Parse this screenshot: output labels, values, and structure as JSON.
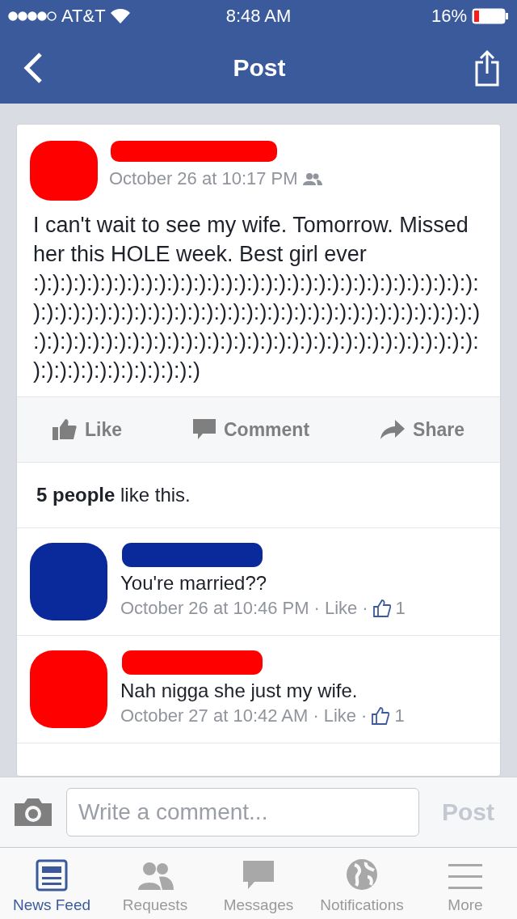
{
  "status_bar": {
    "carrier": "AT&T",
    "time": "8:48 AM",
    "battery": "16%"
  },
  "nav": {
    "title": "Post"
  },
  "post": {
    "time": "October 26 at 10:17 PM",
    "color": "#ff0000",
    "text": "I can't wait to see my wife. Tomorrow. Missed her this HOLE week. Best girl ever :):):):):):):):):):):):):):):):):):):):):):):):):):):):):):):):):):):):):):):):):):):):):):):):):):):):):):):):):):):):):):):):):):):):):):):):):):):):):):):):):):):):):):):):):):):):):):):):):):):):):):):):):):):):):):):):):)",
    "actions": [
      {
        "kind": "like",
        "label": "Like"
      },
      {
        "kind": "comment",
        "label": "Comment"
      },
      {
        "kind": "share",
        "label": "Share"
      }
    ],
    "likes": "**5 people** like this."
  },
  "comments": [
    {
      "color": "#0a2a9c",
      "text": "You're married??",
      "time": "October 26 at 10:46 PM",
      "dot_1": "·",
      "like": "Like",
      "dot_2": "·",
      "count": "1"
    },
    {
      "color": "#ff0000",
      "text": "Nah nigga she just my wife.",
      "time": "October 27 at 10:42 AM",
      "dot_1": "·",
      "like": "Like",
      "dot_2": "·",
      "count": "1"
    }
  ],
  "composer": {
    "placeholder": "Write a comment...",
    "button": "Post"
  },
  "tabs": [
    {
      "kind": "feed",
      "label": "News Feed",
      "selected": true
    },
    {
      "kind": "requests",
      "label": "Requests",
      "selected": false
    },
    {
      "kind": "messages",
      "label": "Messages",
      "selected": false
    },
    {
      "kind": "notifications",
      "label": "Notifications",
      "selected": false
    },
    {
      "kind": "more",
      "label": "More",
      "selected": false
    }
  ]
}
